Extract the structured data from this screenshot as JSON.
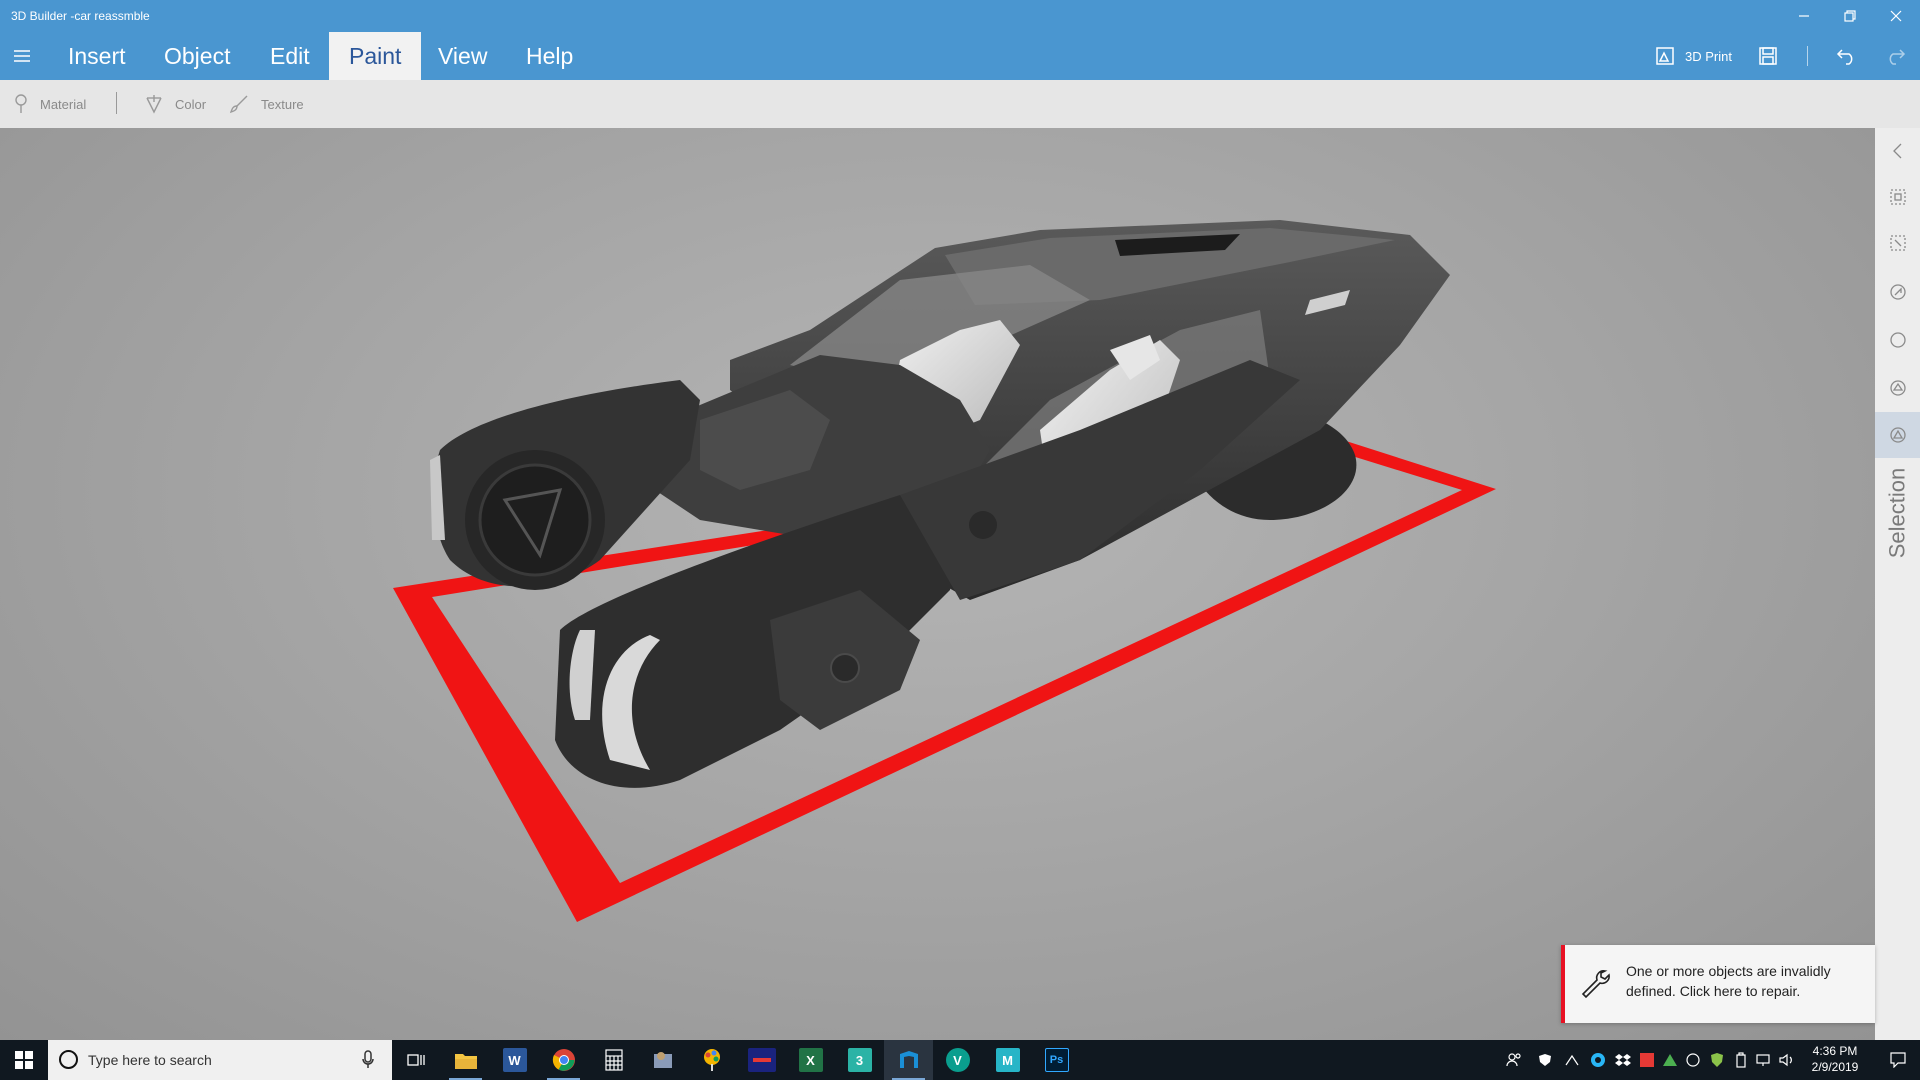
{
  "window": {
    "title": "3D Builder -car reassmble"
  },
  "menu": {
    "tabs": [
      {
        "label": "Insert"
      },
      {
        "label": "Object"
      },
      {
        "label": "Edit"
      },
      {
        "label": "Paint"
      },
      {
        "label": "View"
      },
      {
        "label": "Help"
      }
    ],
    "active_tab": "Paint",
    "print_label": "3D Print"
  },
  "paint_toolbar": {
    "material_label": "Material",
    "color_label": "Color",
    "texture_label": "Texture"
  },
  "side_panel": {
    "label": "Selection"
  },
  "toast": {
    "message": "One or more objects are invalidly defined. Click here to repair."
  },
  "taskbar": {
    "search_placeholder": "Type here to search",
    "time": "4:36 PM",
    "date": "2/9/2019",
    "apps": [
      {
        "name": "task-view",
        "glyph": ""
      },
      {
        "name": "file-explorer",
        "glyph": ""
      },
      {
        "name": "word",
        "glyph": "W",
        "color": "#2b579a"
      },
      {
        "name": "chrome",
        "glyph": ""
      },
      {
        "name": "calculator",
        "glyph": ""
      },
      {
        "name": "app-icon",
        "glyph": ""
      },
      {
        "name": "paint-app",
        "glyph": ""
      },
      {
        "name": "app-tile",
        "glyph": "",
        "color": "#1a237e"
      },
      {
        "name": "excel",
        "glyph": "X",
        "color": "#217346"
      },
      {
        "name": "3d-app",
        "glyph": "3",
        "color": "#2bb3a6"
      },
      {
        "name": "3d-builder",
        "glyph": "",
        "color": "#1a8fd6"
      },
      {
        "name": "vectorworks",
        "glyph": "V",
        "color": "#0a9e8e"
      },
      {
        "name": "maya",
        "glyph": "M",
        "color": "#27b5c7"
      },
      {
        "name": "photoshop",
        "glyph": "Ps",
        "color": "#001d34"
      }
    ]
  },
  "colors": {
    "accent": "#4a96d0",
    "platform": "#f01414",
    "toast_border": "#e81123"
  }
}
